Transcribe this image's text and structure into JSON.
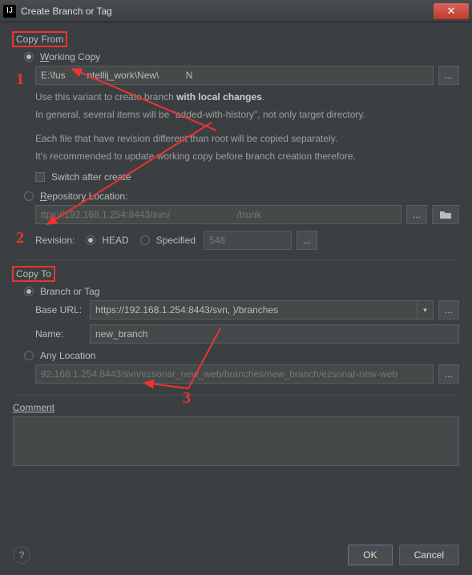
{
  "window": {
    "title": "Create Branch or Tag"
  },
  "copy_from": {
    "legend": "Copy From",
    "working_copy": {
      "label": "Working Copy",
      "path": "E:\\fus        ntellij_work\\New\\          N",
      "desc1_pre": "Use this variant to create branch ",
      "desc1_bold": "with local changes",
      "desc1_post": ".",
      "desc2": "In general, several items will be \"added-with-history\", not only target directory.",
      "desc3": "Each file that have revision different than root will be copied separately.",
      "desc4": "It's recommended to update working copy before branch creation therefore.",
      "switch_label": "Switch after create"
    },
    "repo": {
      "label": "Repository Location:",
      "url": "ttps://192.168.1.254:8443/svn/                         /trunk",
      "revision_label": "Revision:",
      "head_label": "HEAD",
      "specified_label": "Specified",
      "rev_value": "548"
    }
  },
  "copy_to": {
    "legend": "Copy To",
    "branch": {
      "label": "Branch or Tag",
      "base_url_label": "Base URL:",
      "base_url": "https://192.168.1.254:8443/svn,                            )/branches",
      "name_label": "Name:",
      "name": "new_branch"
    },
    "any": {
      "label": "Any Location",
      "url": "92.168.1.254:8443/svn/ezsonar_new_web/branches/new_branch/ezsonar-new-web"
    }
  },
  "comment": {
    "label": "Comment"
  },
  "buttons": {
    "ok": "OK",
    "cancel": "Cancel"
  },
  "annotations": {
    "n1": "1",
    "n2": "2",
    "n3": "3"
  }
}
